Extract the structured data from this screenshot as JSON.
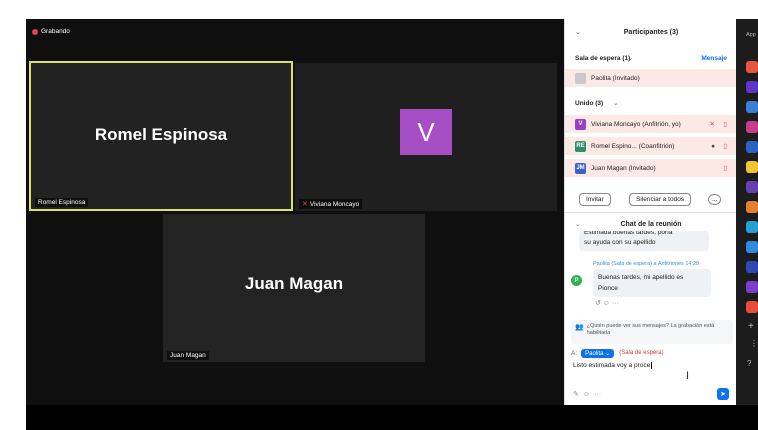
{
  "recording": {
    "label": "Grabando"
  },
  "tiles": [
    {
      "display_name": "Romel Espinosa",
      "label": "Romel Espinosa"
    },
    {
      "display_name": "V",
      "label": "Viviana Moncayo"
    },
    {
      "display_name": "Juan Magan",
      "label": "Juan Magan"
    }
  ],
  "participants_panel": {
    "title": "Participantes (3)",
    "waiting_room": {
      "label": "Sala de espera (1)",
      "message_button": "Mensaje",
      "members": [
        "Paolita (Invitado)"
      ]
    },
    "joined": {
      "label": "Unido (3)",
      "members": [
        {
          "initials": "V",
          "name": "Viviana Moncayo (Anfitrión, yo)",
          "color": "#9b3fc6"
        },
        {
          "initials": "RE",
          "name": "Romel Espino... (Coanfitrión)",
          "color": "#2b8f6a"
        },
        {
          "initials": "JM",
          "name": "Juan Magan (Invitado)",
          "color": "#3b63c7"
        }
      ]
    },
    "invite_button": "Invitar",
    "mute_all_button": "Silenciar a todos",
    "more_button": "..."
  },
  "chat_panel": {
    "title": "Chat de la reunión",
    "messages": [
      {
        "text_line1": "Estimada buenas tardes, porfa",
        "text_line2": "su ayuda con su apellido"
      },
      {
        "header": "Paolita (Sala de espera) a Anfitriones 14:28",
        "initial": "P",
        "text_line1": "Buenas tardes, mi apellido es",
        "text_line2": "Pionce"
      }
    ],
    "notice": "¿Quién puede ver sus mensajes? La grabación está habilitada",
    "to_label": "A:",
    "recipient": "Paolita",
    "recipient_note": "(Sala de espera)",
    "draft": "Listo estimada voy a proce"
  },
  "colors": {
    "accent": "#0e72ed",
    "tile_border": "#d7e36a"
  },
  "app_sidebar_label": "App"
}
